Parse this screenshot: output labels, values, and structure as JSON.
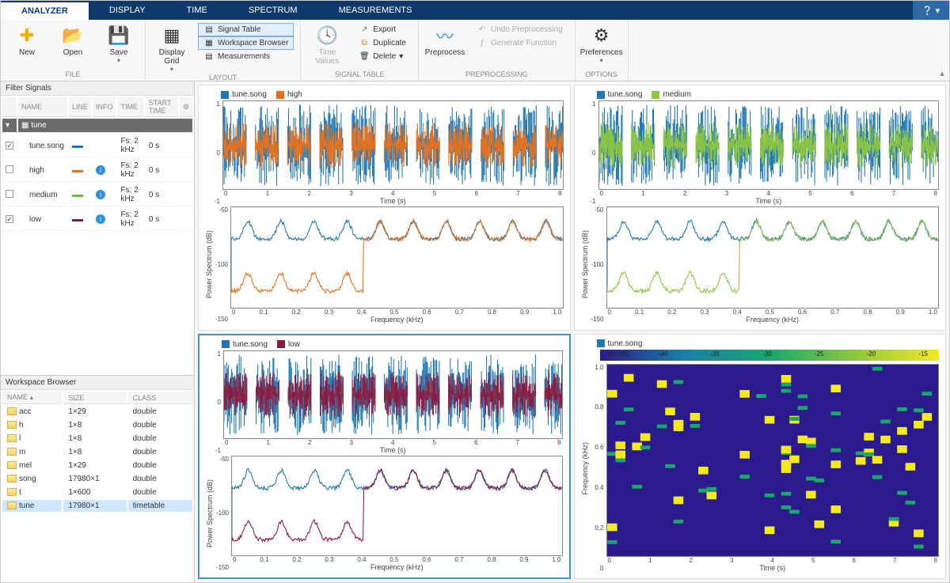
{
  "tabs": [
    "ANALYZER",
    "DISPLAY",
    "TIME",
    "SPECTRUM",
    "MEASUREMENTS"
  ],
  "active_tab": 0,
  "ribbon": {
    "file": {
      "label": "FILE",
      "new": "New",
      "open": "Open",
      "save": "Save"
    },
    "layout": {
      "label": "LAYOUT",
      "display_grid": "Display Grid",
      "signal_table": "Signal Table",
      "workspace_browser": "Workspace Browser",
      "measurements": "Measurements"
    },
    "signal_table": {
      "label": "SIGNAL TABLE",
      "time_values": "Time Values",
      "export": "Export",
      "duplicate": "Duplicate",
      "delete": "Delete"
    },
    "preprocessing": {
      "label": "PREPROCESSING",
      "preprocess": "Preprocess",
      "undo": "Undo Preprocessing",
      "genfunc": "Generate Function"
    },
    "options": {
      "label": "OPTIONS",
      "preferences": "Preferences"
    }
  },
  "filter_panel": {
    "title": "Filter Signals",
    "cols": {
      "name": "NAME",
      "line": "LINE",
      "info": "INFO",
      "time": "TIME",
      "start": "START TIME"
    },
    "group": "tune",
    "rows": [
      {
        "checked": true,
        "name": "tune.song",
        "color": "#1f77b4",
        "info": false,
        "fs": "Fs: 2 kHz",
        "start": "0 s"
      },
      {
        "checked": false,
        "name": "high",
        "color": "#e8701a",
        "info": true,
        "fs": "Fs: 2 kHz",
        "start": "0 s"
      },
      {
        "checked": false,
        "name": "medium",
        "color": "#6abf2a",
        "info": true,
        "fs": "Fs: 2 kHz",
        "start": "0 s"
      },
      {
        "checked": true,
        "name": "low",
        "color": "#8b1a3c",
        "info": true,
        "fs": "Fs: 2 kHz",
        "start": "0 s"
      }
    ]
  },
  "workspace": {
    "title": "Workspace Browser",
    "cols": {
      "name": "NAME",
      "size": "SIZE",
      "class": "CLASS"
    },
    "vars": [
      {
        "name": "acc",
        "size": "1×29",
        "class": "double"
      },
      {
        "name": "h",
        "size": "1×8",
        "class": "double"
      },
      {
        "name": "l",
        "size": "1×8",
        "class": "double"
      },
      {
        "name": "m",
        "size": "1×8",
        "class": "double"
      },
      {
        "name": "mel",
        "size": "1×29",
        "class": "double"
      },
      {
        "name": "song",
        "size": "17980×1",
        "class": "double"
      },
      {
        "name": "t",
        "size": "1×600",
        "class": "double"
      },
      {
        "name": "tune",
        "size": "17980×1",
        "class": "timetable",
        "selected": true
      }
    ]
  },
  "charts": {
    "time_x_ticks": [
      "0",
      "1",
      "2",
      "3",
      "4",
      "5",
      "6",
      "7",
      "8"
    ],
    "time_xlabel": "Time (s)",
    "freq_x_ticks": [
      "0",
      "0.1",
      "0.2",
      "0.3",
      "0.4",
      "0.5",
      "0.6",
      "0.7",
      "0.8",
      "0.9",
      "1.0"
    ],
    "freq_xlabel": "Frequency (kHz)",
    "panels": [
      {
        "legend": [
          {
            "name": "tune.song",
            "color": "#1f77b4"
          },
          {
            "name": "high",
            "color": "#e8701a"
          }
        ],
        "time_yticks": [
          "1",
          "0",
          "-1"
        ],
        "spec_yticks": [
          "-50",
          "-100",
          "-150"
        ],
        "spec_ylabel": "Power Spectrum (dB)"
      },
      {
        "legend": [
          {
            "name": "tune.song",
            "color": "#1f77b4"
          },
          {
            "name": "medium",
            "color": "#8cc63f"
          }
        ],
        "time_yticks": [
          "1",
          "0",
          "-1"
        ],
        "spec_yticks": [
          "-50",
          "-100",
          "-150"
        ],
        "spec_ylabel": "Power Spectrum (dB)"
      },
      {
        "legend": [
          {
            "name": "tune.song",
            "color": "#1f77b4"
          },
          {
            "name": "low",
            "color": "#8b1a3c"
          }
        ],
        "time_yticks": [
          "1",
          "0",
          "-1"
        ],
        "spec_yticks": [
          "-50",
          "-100",
          "-150"
        ],
        "spec_ylabel": "Power Spectrum (dB)",
        "selected": true
      },
      {
        "legend": [
          {
            "name": "tune.song",
            "color": "#1f77b4"
          }
        ],
        "spectrogram": true,
        "y_ticks": [
          "1.0",
          "0.8",
          "0.6",
          "0.4",
          "0.2",
          "0"
        ],
        "ylabel": "Frequency (kHz)",
        "cbar_ticks": [
          "-45 (dB)",
          "-40",
          "-35",
          "-30",
          "-25",
          "-20",
          "-15"
        ]
      }
    ]
  },
  "colors": {
    "blue": "#1f77b4",
    "orange": "#e8701a",
    "green": "#8cc63f",
    "darkred": "#8b1a3c"
  }
}
